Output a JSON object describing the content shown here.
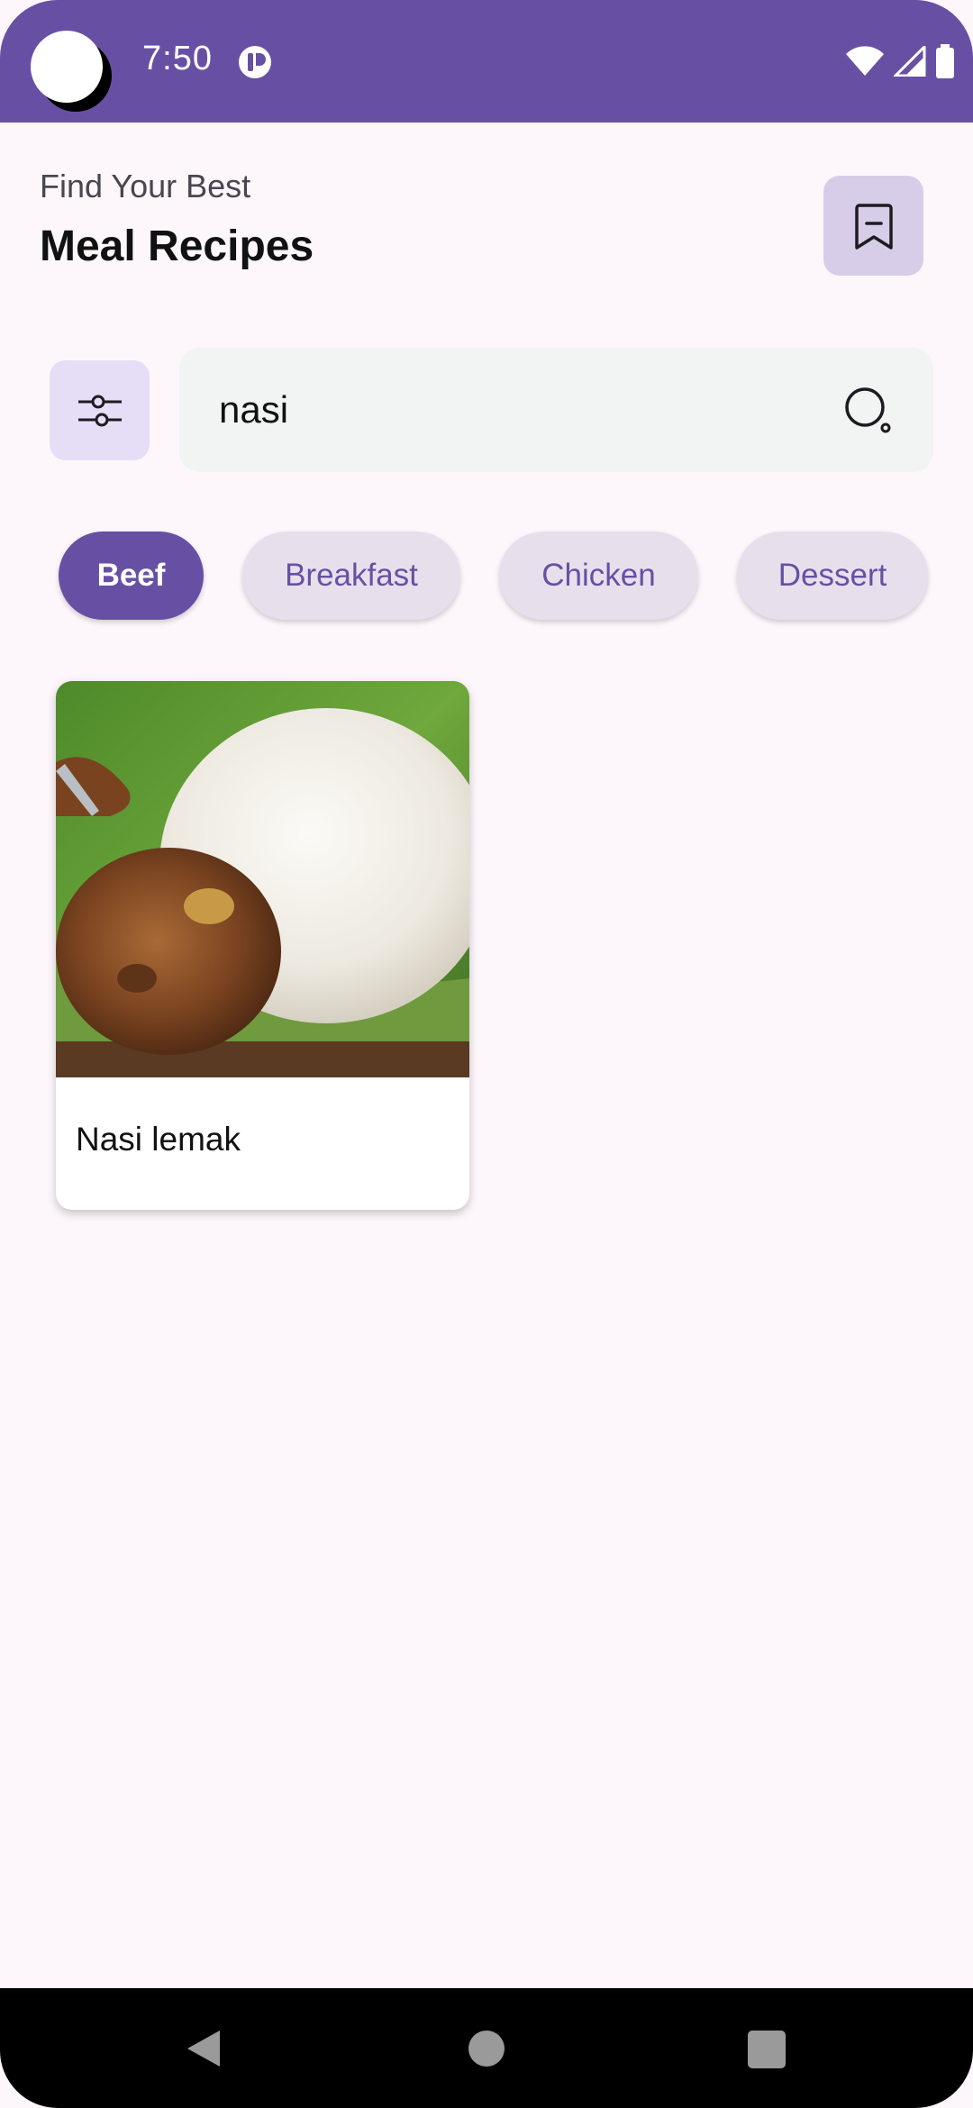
{
  "status_bar": {
    "time": "7:50",
    "app_icon": "notification-app-icon",
    "wifi_icon": "wifi-icon",
    "signal_icon": "cell-signal-icon",
    "battery_icon": "battery-icon"
  },
  "header": {
    "subtitle": "Find Your Best",
    "title": "Meal Recipes",
    "bookmark_icon": "bookmark-icon"
  },
  "search": {
    "value": "nasi",
    "filter_icon": "filter-sliders-icon",
    "search_icon": "search-icon"
  },
  "categories": [
    {
      "label": "Beef",
      "selected": true
    },
    {
      "label": "Breakfast",
      "selected": false
    },
    {
      "label": "Chicken",
      "selected": false
    },
    {
      "label": "Dessert",
      "selected": false
    }
  ],
  "recipes": [
    {
      "name": "Nasi lemak",
      "image": "nasi-lemak-photo"
    }
  ],
  "nav_bar": {
    "back_icon": "back-icon",
    "home_icon": "home-icon",
    "recents_icon": "recents-icon"
  },
  "colors": {
    "primary": "#6750A4",
    "background": "#FDF7FC",
    "chip_background": "#E7E0EC",
    "search_background": "#F2F4F4"
  }
}
